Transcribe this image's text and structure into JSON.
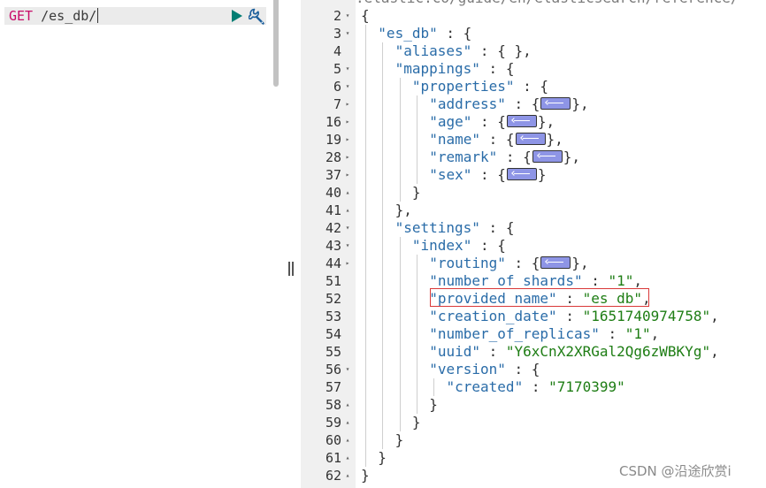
{
  "request": {
    "method": "GET",
    "path": " /es_db/"
  },
  "response": {
    "top_partial_text": ".elastic.co/guide/en/elasticsearch/reference/",
    "lines": [
      {
        "n": "2",
        "fold": "down",
        "indent": 0,
        "tokens": [
          [
            "p",
            "{"
          ]
        ]
      },
      {
        "n": "3",
        "fold": "down",
        "indent": 1,
        "tokens": [
          [
            "k",
            "\"es_db\""
          ],
          [
            "p",
            " : {"
          ]
        ]
      },
      {
        "n": "4",
        "fold": "",
        "indent": 2,
        "tokens": [
          [
            "k",
            "\"aliases\""
          ],
          [
            "p",
            " : { },"
          ]
        ]
      },
      {
        "n": "5",
        "fold": "down",
        "indent": 2,
        "tokens": [
          [
            "k",
            "\"mappings\""
          ],
          [
            "p",
            " : {"
          ]
        ]
      },
      {
        "n": "6",
        "fold": "down",
        "indent": 3,
        "tokens": [
          [
            "k",
            "\"properties\""
          ],
          [
            "p",
            " : {"
          ]
        ]
      },
      {
        "n": "7",
        "fold": "right",
        "indent": 4,
        "tokens": [
          [
            "k",
            "\"address\""
          ],
          [
            "p",
            " : {"
          ],
          [
            "b",
            ""
          ],
          [
            "p",
            "},"
          ]
        ]
      },
      {
        "n": "16",
        "fold": "right",
        "indent": 4,
        "tokens": [
          [
            "k",
            "\"age\""
          ],
          [
            "p",
            " : {"
          ],
          [
            "b",
            ""
          ],
          [
            "p",
            "},"
          ]
        ]
      },
      {
        "n": "19",
        "fold": "right",
        "indent": 4,
        "tokens": [
          [
            "k",
            "\"name\""
          ],
          [
            "p",
            " : {"
          ],
          [
            "b",
            ""
          ],
          [
            "p",
            "},"
          ]
        ]
      },
      {
        "n": "28",
        "fold": "right",
        "indent": 4,
        "tokens": [
          [
            "k",
            "\"remark\""
          ],
          [
            "p",
            " : {"
          ],
          [
            "b",
            ""
          ],
          [
            "p",
            "},"
          ]
        ]
      },
      {
        "n": "37",
        "fold": "right",
        "indent": 4,
        "tokens": [
          [
            "k",
            "\"sex\""
          ],
          [
            "p",
            " : {"
          ],
          [
            "b",
            ""
          ],
          [
            "p",
            "}"
          ]
        ]
      },
      {
        "n": "40",
        "fold": "up",
        "indent": 3,
        "tokens": [
          [
            "p",
            "}"
          ]
        ]
      },
      {
        "n": "41",
        "fold": "up",
        "indent": 2,
        "tokens": [
          [
            "p",
            "},"
          ]
        ]
      },
      {
        "n": "42",
        "fold": "down",
        "indent": 2,
        "tokens": [
          [
            "k",
            "\"settings\""
          ],
          [
            "p",
            " : {"
          ]
        ]
      },
      {
        "n": "43",
        "fold": "down",
        "indent": 3,
        "tokens": [
          [
            "k",
            "\"index\""
          ],
          [
            "p",
            " : {"
          ]
        ]
      },
      {
        "n": "44",
        "fold": "right",
        "indent": 4,
        "tokens": [
          [
            "k",
            "\"routing\""
          ],
          [
            "p",
            " : {"
          ],
          [
            "b",
            ""
          ],
          [
            "p",
            "},"
          ]
        ]
      },
      {
        "n": "51",
        "fold": "",
        "indent": 4,
        "tokens": [
          [
            "k",
            "\"number_of_shards\""
          ],
          [
            "p",
            " : "
          ],
          [
            "v",
            "\"1\""
          ],
          [
            "p",
            ","
          ]
        ]
      },
      {
        "n": "52",
        "fold": "",
        "indent": 4,
        "tokens": [
          [
            "k",
            "\"provided_name\""
          ],
          [
            "p",
            " : "
          ],
          [
            "v",
            "\"es_db\""
          ],
          [
            "p",
            ","
          ]
        ]
      },
      {
        "n": "53",
        "fold": "",
        "indent": 4,
        "tokens": [
          [
            "k",
            "\"creation_date\""
          ],
          [
            "p",
            " : "
          ],
          [
            "v",
            "\"1651740974758\""
          ],
          [
            "p",
            ","
          ]
        ]
      },
      {
        "n": "54",
        "fold": "",
        "indent": 4,
        "tokens": [
          [
            "k",
            "\"number_of_replicas\""
          ],
          [
            "p",
            " : "
          ],
          [
            "v",
            "\"1\""
          ],
          [
            "p",
            ","
          ]
        ]
      },
      {
        "n": "55",
        "fold": "",
        "indent": 4,
        "tokens": [
          [
            "k",
            "\"uuid\""
          ],
          [
            "p",
            " : "
          ],
          [
            "v",
            "\"Y6xCnX2XRGal2Qg6zWBKYg\""
          ],
          [
            "p",
            ","
          ]
        ]
      },
      {
        "n": "56",
        "fold": "down",
        "indent": 4,
        "tokens": [
          [
            "k",
            "\"version\""
          ],
          [
            "p",
            " : {"
          ]
        ]
      },
      {
        "n": "57",
        "fold": "",
        "indent": 5,
        "tokens": [
          [
            "k",
            "\"created\""
          ],
          [
            "p",
            " : "
          ],
          [
            "v",
            "\"7170399\""
          ]
        ]
      },
      {
        "n": "58",
        "fold": "up",
        "indent": 4,
        "tokens": [
          [
            "p",
            "}"
          ]
        ]
      },
      {
        "n": "59",
        "fold": "up",
        "indent": 3,
        "tokens": [
          [
            "p",
            "}"
          ]
        ]
      },
      {
        "n": "60",
        "fold": "up",
        "indent": 2,
        "tokens": [
          [
            "p",
            "}"
          ]
        ]
      },
      {
        "n": "61",
        "fold": "up",
        "indent": 1,
        "tokens": [
          [
            "p",
            "}"
          ]
        ]
      },
      {
        "n": "62",
        "fold": "up",
        "indent": 0,
        "tokens": [
          [
            "p",
            "}"
          ]
        ]
      }
    ]
  },
  "icons": {
    "play": "play-icon",
    "wrench": "wrench-icon",
    "fold_down": "fold-down-icon",
    "fold_up": "fold-up-icon",
    "fold_right": "fold-right-icon",
    "collapsed": "collapsed-object-icon"
  },
  "colors": {
    "method": "#c80a68",
    "key": "#2a6ca8",
    "string": "#1e7d14",
    "play_button": "#017d73",
    "badge": "#8e95e6",
    "highlight": "#d93838"
  },
  "watermark": "CSDN @沿途欣赏i"
}
